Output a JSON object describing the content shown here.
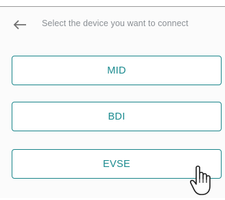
{
  "header": {
    "prompt": "Select the device you want to connect",
    "back_icon": "arrow-left-icon"
  },
  "devices": [
    {
      "label": "MID"
    },
    {
      "label": "BDI"
    },
    {
      "label": "EVSE"
    }
  ],
  "cursor": {
    "icon": "hand-pointer-icon"
  },
  "colors": {
    "accent": "#19858a",
    "prompt_text": "#8a8f94",
    "background": "#fbfbfb",
    "button_background": "#ffffff"
  }
}
